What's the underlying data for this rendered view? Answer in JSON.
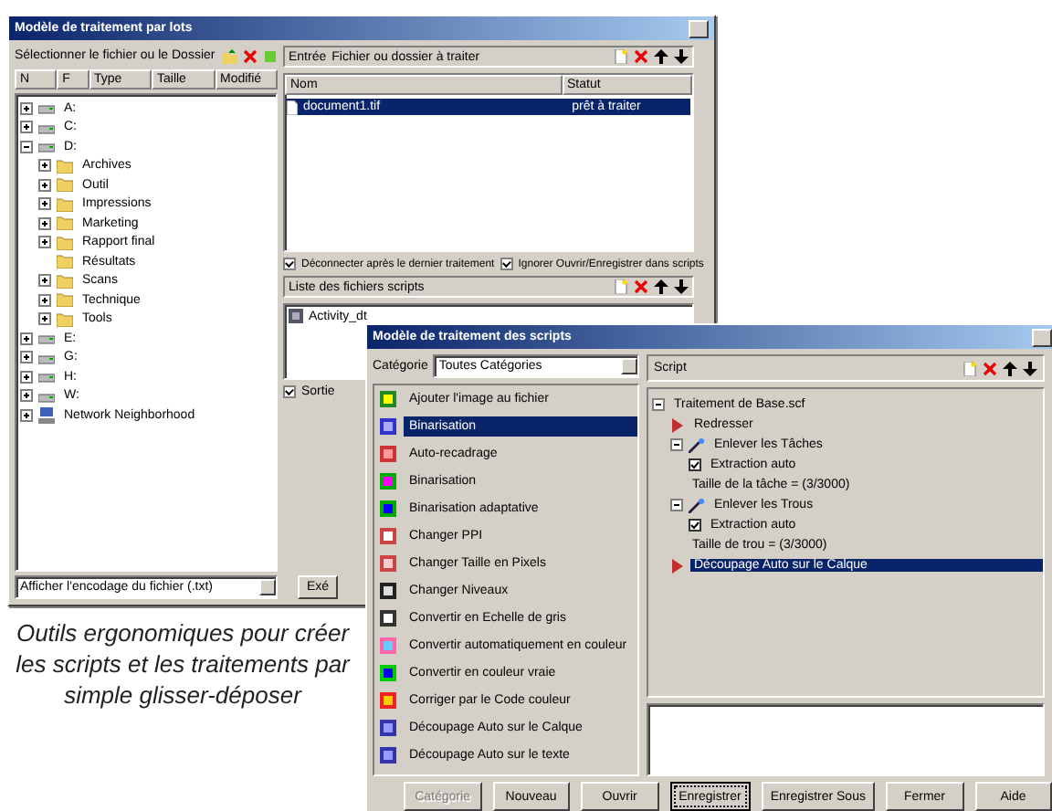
{
  "batch_window": {
    "title": "Modèle de traitement par lots",
    "source_label": "Sélectionner le fichier ou le Dossier",
    "columns": [
      "N",
      "F",
      "Type",
      "Taille",
      "Modifié"
    ],
    "tree": [
      {
        "label": "A:",
        "kind": "drive",
        "expanded": false
      },
      {
        "label": "C:",
        "kind": "drive",
        "expanded": false
      },
      {
        "label": "D:",
        "kind": "drive",
        "expanded": true,
        "children": [
          {
            "label": "Archives",
            "kind": "folder",
            "expanded": false
          },
          {
            "label": "Outil",
            "kind": "folder",
            "expanded": false
          },
          {
            "label": "Impressions",
            "kind": "folder",
            "expanded": false
          },
          {
            "label": "Marketing",
            "kind": "folder",
            "expanded": false
          },
          {
            "label": "Rapport final",
            "kind": "folder",
            "expanded": false
          },
          {
            "label": "Résultats",
            "kind": "folder"
          },
          {
            "label": "Scans",
            "kind": "folder",
            "expanded": false
          },
          {
            "label": "Technique",
            "kind": "folder",
            "expanded": false
          },
          {
            "label": "Tools",
            "kind": "folder",
            "expanded": false
          }
        ]
      },
      {
        "label": "E:",
        "kind": "drive",
        "expanded": false
      },
      {
        "label": "G:",
        "kind": "drive",
        "expanded": false
      },
      {
        "label": "H:",
        "kind": "drive",
        "expanded": false
      },
      {
        "label": "W:",
        "kind": "drive",
        "expanded": false
      },
      {
        "label": "Network Neighborhood",
        "kind": "network",
        "expanded": false
      }
    ],
    "filter": "Afficher l'encodage du fichier (.txt)",
    "input_label": "Entrée",
    "input_hint": "Fichier ou dossier à traiter",
    "input_columns": [
      "Nom",
      "Statut"
    ],
    "input_rows": [
      {
        "name": "document1.tif",
        "status": "prêt à traiter",
        "selected": true
      }
    ],
    "options": [
      {
        "label": "Déconnecter après le dernier traitement",
        "checked": true
      },
      {
        "label": "Ignorer Ouvrir/Enregistrer dans scripts",
        "checked": true
      }
    ],
    "scripts_label": "Liste des fichiers scripts",
    "scripts": [
      {
        "label": "Activity_dt"
      }
    ],
    "output": {
      "label": "Sortie",
      "checked": true
    },
    "run_button": "Exé"
  },
  "script_window": {
    "title": "Modèle de traitement des scripts",
    "category_label": "Catégorie",
    "category": "Toutes Catégories",
    "commands": [
      {
        "label": "Ajouter l'image au fichier",
        "selected": false
      },
      {
        "label": "Binarisation",
        "selected": true
      },
      {
        "label": "Auto-recadrage",
        "selected": false
      },
      {
        "label": "Binarisation",
        "selected": false
      },
      {
        "label": "Binarisation adaptative",
        "selected": false
      },
      {
        "label": "Changer PPI",
        "selected": false
      },
      {
        "label": "Changer Taille en Pixels",
        "selected": false
      },
      {
        "label": "Changer Niveaux",
        "selected": false
      },
      {
        "label": "Convertir en Echelle de gris",
        "selected": false
      },
      {
        "label": "Convertir automatiquement en couleur",
        "selected": false
      },
      {
        "label": "Convertir en couleur vraie",
        "selected": false
      },
      {
        "label": "Corriger par le Code couleur",
        "selected": false
      },
      {
        "label": "Découpage Auto sur le Calque",
        "selected": false
      },
      {
        "label": "Découpage Auto sur le texte",
        "selected": false
      }
    ],
    "script_label": "Script",
    "script_tree": [
      {
        "label": "Traitement de Base.scf",
        "expanded": true,
        "selected": false,
        "children": [
          {
            "label": "Redresser",
            "kind": "step",
            "selected": false
          },
          {
            "label": "Enlever les Tâches",
            "kind": "group",
            "expanded": true,
            "selected": false,
            "children": [
              {
                "label": "Extraction auto",
                "kind": "option",
                "selected": false
              },
              {
                "label": "Taille de la tâche = (3/3000)",
                "selected": false
              }
            ]
          },
          {
            "label": "Enlever les Trous",
            "kind": "group",
            "expanded": true,
            "selected": false,
            "children": [
              {
                "label": "Extraction auto",
                "kind": "option",
                "selected": false
              },
              {
                "label": "Taille de trou = (3/3000)",
                "selected": false
              }
            ]
          },
          {
            "label": "Découpage Auto sur le Calque",
            "kind": "step",
            "selected": true
          }
        ]
      }
    ],
    "buttons": [
      {
        "label": "Catégorie",
        "disabled": true,
        "pressed": false
      },
      {
        "label": "Nouveau",
        "disabled": false,
        "pressed": false
      },
      {
        "label": "Ouvrir",
        "disabled": false,
        "pressed": false
      },
      {
        "label": "Enregistrer",
        "disabled": false,
        "pressed": true
      },
      {
        "label": "Enregistrer Sous",
        "disabled": false,
        "pressed": false
      },
      {
        "label": "Fermer",
        "disabled": false,
        "pressed": false
      },
      {
        "label": "Aide",
        "disabled": false,
        "pressed": false
      }
    ]
  },
  "caption": "Outils ergonomiques pour créer les scripts et les traitements par simple glisser-déposer"
}
